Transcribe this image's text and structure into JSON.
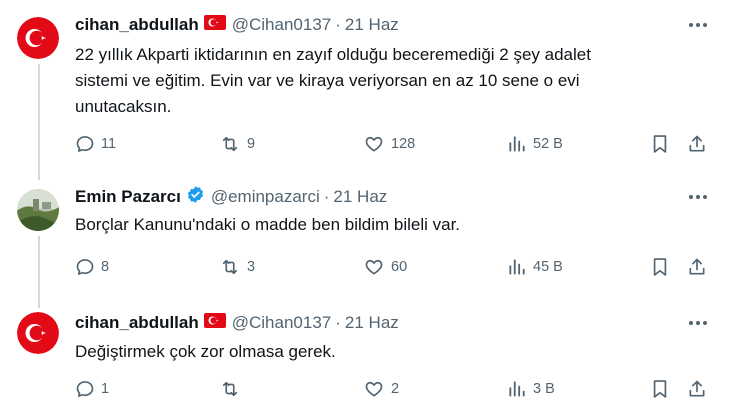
{
  "tweets": [
    {
      "name": "cihan_abdullah",
      "handle": "@Cihan0137",
      "separator": "·",
      "date": "21 Haz",
      "text": "22 yıllık Akparti iktidarının en zayıf olduğu beceremediği 2 şey adalet\nsistemi ve eğitim. Evin var ve kiraya veriyorsan en az 10 sene o evi\nunutacaksın.",
      "replies": "11",
      "retweets": "9",
      "likes": "128",
      "views": "52 B"
    },
    {
      "name": "Emin Pazarcı",
      "handle": "@eminpazarci",
      "separator": "·",
      "date": "21 Haz",
      "text": "Borçlar Kanunu'ndaki o madde ben bildim bileli var.",
      "replies": "8",
      "retweets": "3",
      "likes": "60",
      "views": "45 B"
    },
    {
      "name": "cihan_abdullah",
      "handle": "@Cihan0137",
      "separator": "·",
      "date": "21 Haz",
      "text": "Değiştirmek çok zor olmasa gerek.",
      "replies": "1",
      "retweets": "",
      "likes": "2",
      "views": "3 B"
    }
  ],
  "colors": {
    "text": "#0f1419",
    "secondary": "#536471",
    "verified": "#1d9bf0",
    "turkey_red": "#e30a17",
    "thread_line": "#cfd9de"
  }
}
